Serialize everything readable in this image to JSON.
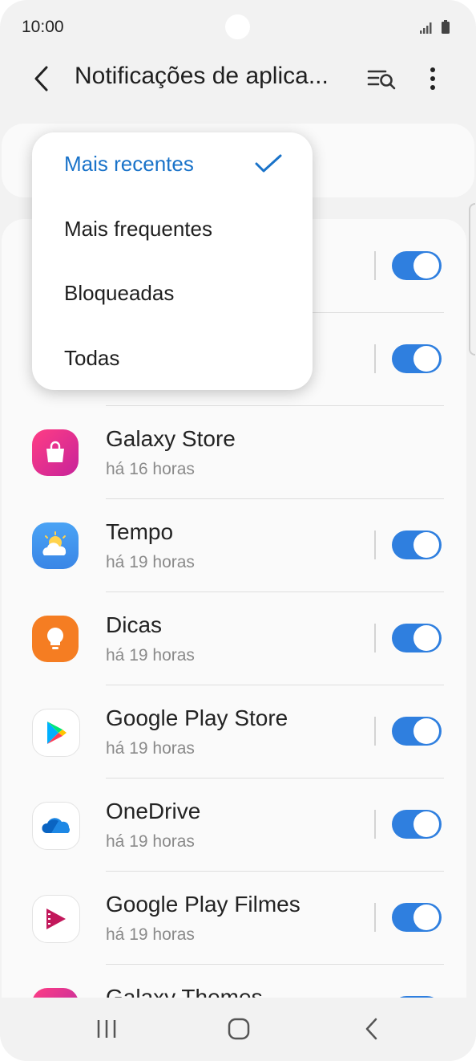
{
  "status_bar": {
    "time": "10:00"
  },
  "header": {
    "title": "Notificações de aplica..."
  },
  "sort_menu": {
    "items": [
      {
        "label": "Mais recentes",
        "selected": true
      },
      {
        "label": "Mais frequentes",
        "selected": false
      },
      {
        "label": "Bloqueadas",
        "selected": false
      },
      {
        "label": "Todas",
        "selected": false
      }
    ]
  },
  "apps": [
    {
      "name": "",
      "time": "",
      "toggle": "on"
    },
    {
      "name": "",
      "time": "",
      "toggle": "on"
    },
    {
      "name": "Galaxy Store",
      "time": "há 16 horas",
      "icon": "galaxy-store-icon",
      "toggle": "none"
    },
    {
      "name": "Tempo",
      "time": "há 19 horas",
      "icon": "weather-icon",
      "toggle": "on"
    },
    {
      "name": "Dicas",
      "time": "há 19 horas",
      "icon": "tips-bulb-icon",
      "toggle": "on"
    },
    {
      "name": "Google Play Store",
      "time": "há 19 horas",
      "icon": "google-play-icon",
      "toggle": "on"
    },
    {
      "name": "OneDrive",
      "time": "há 19 horas",
      "icon": "onedrive-icon",
      "toggle": "on"
    },
    {
      "name": "Google Play Filmes",
      "time": "há 19 horas",
      "icon": "play-movies-icon",
      "toggle": "on"
    },
    {
      "name": "Galaxy Themes",
      "time": "",
      "icon": "galaxy-themes-icon",
      "toggle": "on"
    }
  ],
  "colors": {
    "accent": "#2f7fdf",
    "selected_text": "#1a73c9"
  }
}
